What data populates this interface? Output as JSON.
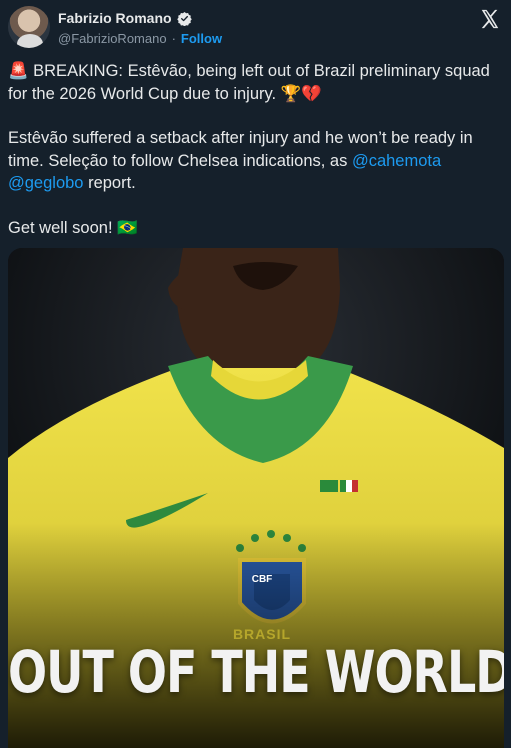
{
  "author": {
    "name": "Fabrizio Romano",
    "handle": "@FabrizioRomano",
    "separator": "·",
    "follow_label": "Follow"
  },
  "icons": {
    "verified": "verified-badge-icon",
    "x_logo": "x-logo-icon",
    "siren": "🚨",
    "trophy": "🏆",
    "broken_heart": "💔",
    "brazil_flag": "🇧🇷"
  },
  "tweet": {
    "line1_text": "BREAKING: Estêvão, being left out of Brazil preliminary squad for the 2026 World Cup due to injury.",
    "line2_text": "Estêvão suffered a setback after injury and he won’t be ready in time. Seleção to follow Chelsea indications, as",
    "mention1": "@cahemota",
    "mention2": "@geglobo",
    "line2_end": "report.",
    "line3_text": "Get well soon!"
  },
  "media": {
    "caption": "OUT OF THE WORLD CUP",
    "crest_label": "CBF",
    "chest_text": "BRASIL"
  },
  "colors": {
    "background": "#15202b",
    "link": "#1d9bf0",
    "jersey": "#e6d738",
    "collar": "#3a9a4a"
  }
}
